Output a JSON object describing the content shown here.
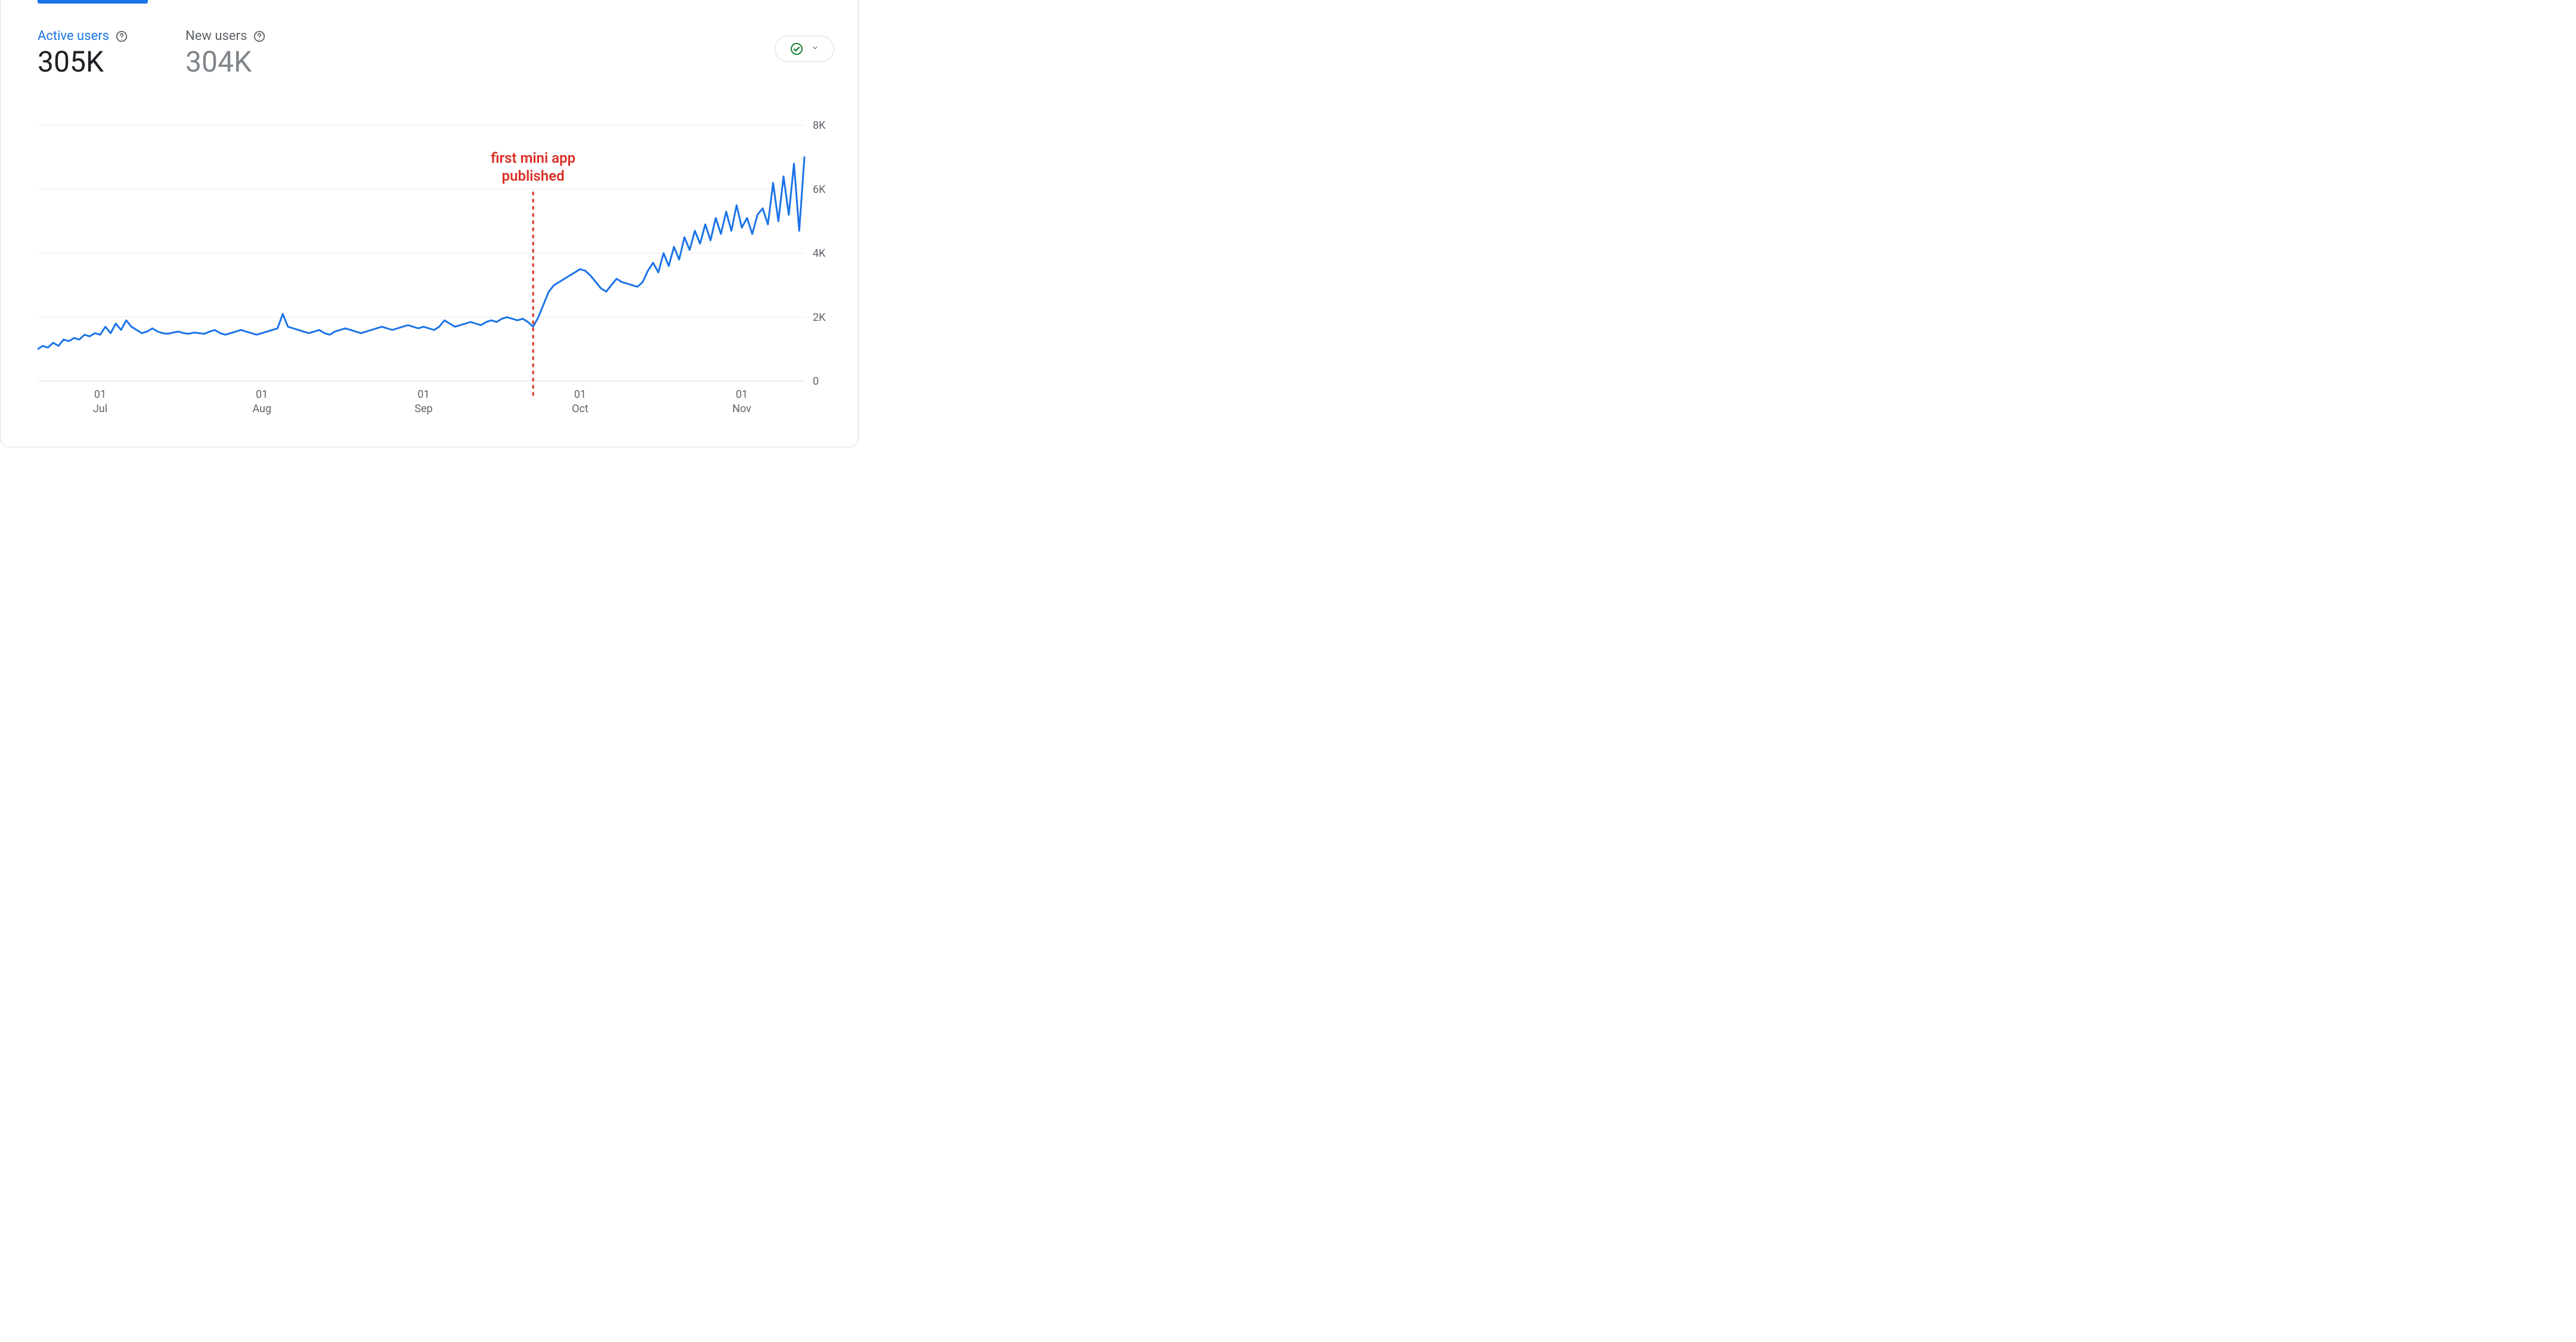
{
  "metrics": {
    "active_users": {
      "label": "Active users",
      "value": "305K"
    },
    "new_users": {
      "label": "New users",
      "value": "304K"
    }
  },
  "annotation": {
    "line1": "first mini app",
    "line2": "published"
  },
  "chart_data": {
    "type": "line",
    "ylabel": "",
    "xlabel": "",
    "ylim": [
      0,
      8000
    ],
    "y_ticks": [
      "0",
      "2K",
      "4K",
      "6K",
      "8K"
    ],
    "x_tick_labels": [
      {
        "top": "01",
        "bottom": "Jul"
      },
      {
        "top": "01",
        "bottom": "Aug"
      },
      {
        "top": "01",
        "bottom": "Sep"
      },
      {
        "top": "01",
        "bottom": "Oct"
      },
      {
        "top": "01",
        "bottom": "Nov"
      }
    ],
    "x_tick_indices": [
      12,
      43,
      74,
      104,
      135
    ],
    "annotation_index": 95,
    "series": [
      {
        "name": "Active users",
        "color": "#1a73e8",
        "values": [
          1000,
          1100,
          1050,
          1200,
          1100,
          1300,
          1250,
          1350,
          1300,
          1450,
          1400,
          1500,
          1450,
          1700,
          1500,
          1800,
          1600,
          1900,
          1700,
          1600,
          1500,
          1550,
          1650,
          1550,
          1500,
          1480,
          1520,
          1550,
          1500,
          1480,
          1520,
          1500,
          1480,
          1550,
          1600,
          1500,
          1450,
          1500,
          1550,
          1600,
          1550,
          1500,
          1450,
          1500,
          1550,
          1600,
          1650,
          2100,
          1700,
          1650,
          1600,
          1550,
          1500,
          1550,
          1600,
          1500,
          1450,
          1550,
          1600,
          1650,
          1600,
          1550,
          1500,
          1550,
          1600,
          1650,
          1700,
          1650,
          1600,
          1650,
          1700,
          1750,
          1700,
          1650,
          1700,
          1650,
          1600,
          1700,
          1900,
          1800,
          1700,
          1750,
          1800,
          1850,
          1800,
          1750,
          1850,
          1900,
          1850,
          1950,
          2000,
          1950,
          1900,
          1950,
          1850,
          1700,
          2000,
          2400,
          2800,
          3000,
          3100,
          3200,
          3300,
          3400,
          3500,
          3450,
          3300,
          3100,
          2900,
          2800,
          3000,
          3200,
          3100,
          3050,
          3000,
          2950,
          3100,
          3450,
          3700,
          3400,
          4000,
          3600,
          4200,
          3800,
          4500,
          4100,
          4700,
          4300,
          4900,
          4400,
          5100,
          4600,
          5300,
          4700,
          5500,
          4800,
          5100,
          4600,
          5200,
          5400,
          4900,
          6200,
          5000,
          6400,
          5200,
          6800,
          4700,
          7000
        ]
      }
    ]
  }
}
